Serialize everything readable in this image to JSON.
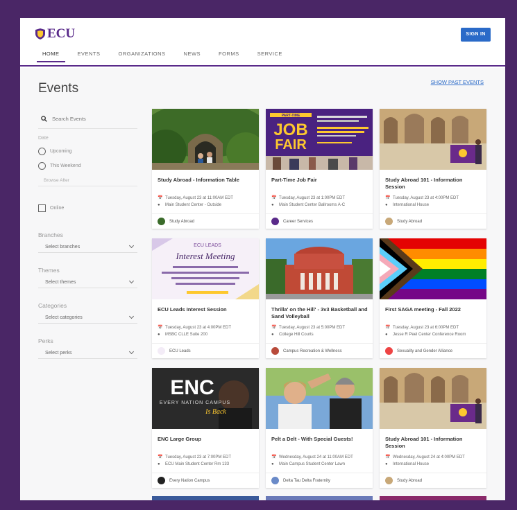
{
  "header": {
    "logo_text": "ECU",
    "nav": [
      "HOME",
      "EVENTS",
      "ORGANIZATIONS",
      "NEWS",
      "FORMS",
      "SERVICE"
    ],
    "active_nav": 0,
    "signin_label": "SIGN IN"
  },
  "page": {
    "title": "Events",
    "show_past_label": "SHOW PAST EVENTS"
  },
  "sidebar": {
    "search_placeholder": "Search Events",
    "date_label": "Date",
    "radio_options": [
      "Upcoming",
      "This Weekend"
    ],
    "date_input_placeholder": "Browse After",
    "online_label": "Online",
    "filters": [
      {
        "label": "Branches",
        "select": "Select branches"
      },
      {
        "label": "Themes",
        "select": "Select themes"
      },
      {
        "label": "Categories",
        "select": "Select categories"
      },
      {
        "label": "Perks",
        "select": "Select perks"
      }
    ]
  },
  "events": [
    {
      "title": "Study Abroad - Information Table",
      "datetime": "Tuesday, August 23 at 11:00AM EDT",
      "location": "Main Student Center - Outside",
      "org": "Study Abroad",
      "image": "garden-hut",
      "accent": "#3a6b2a"
    },
    {
      "title": "Part-Time Job Fair",
      "datetime": "Tuesday, August 23 at 1:00PM EDT",
      "location": "Main Student Center Ballrooms A-C",
      "org": "Career Services",
      "image": "job-fair",
      "accent": "#5a2a8a"
    },
    {
      "title": "Study Abroad 101 - Information Session",
      "datetime": "Tuesday, August 23 at 4:00PM EDT",
      "location": "International House",
      "org": "Study Abroad",
      "image": "ruins",
      "accent": "#c8a878"
    },
    {
      "title": "ECU Leads Interest Session",
      "datetime": "Tuesday, August 23 at 4:00PM EDT",
      "location": "MSBC CLLE Suite 200",
      "org": "ECU Leads",
      "image": "leads-flyer",
      "accent": "#f3ecf7"
    },
    {
      "title": "Thrilla' on the Hill' - 3v3 Basketball and Sand Volleyball",
      "datetime": "Tuesday, August 23 at 5:00PM EDT",
      "location": "College Hill Courts",
      "org": "Campus Recreation & Wellness",
      "image": "building",
      "accent": "#b84a3a"
    },
    {
      "title": "First SAGA meeting - Fall 2022",
      "datetime": "Tuesday, August 23 at 6:00PM EDT",
      "location": "Jesse R Peel Center Conference Room",
      "org": "Sexuality and Gender Alliance",
      "image": "pride-flag",
      "accent": "#e44"
    },
    {
      "title": "ENC Large Group",
      "datetime": "Tuesday, August 23 at 7:00PM EDT",
      "location": "ECU Main Student Center Rm 133",
      "org": "Every Nation Campus",
      "image": "enc",
      "accent": "#222"
    },
    {
      "title": "Pelt a Delt - With Special Guests!",
      "datetime": "Wednesday, August 24 at 11:00AM EDT",
      "location": "Main Campus Student Center Lawn",
      "org": "Delta Tau Delta Fraternity",
      "image": "people",
      "accent": "#6a8ac8"
    },
    {
      "title": "Study Abroad 101 - Information Session",
      "datetime": "Wednesday, August 24 at 4:00PM EDT",
      "location": "International House",
      "org": "Study Abroad",
      "image": "ruins",
      "accent": "#c8a878"
    }
  ],
  "job_fair_graphic": {
    "line1": "PART-TIME",
    "line2": "JOB",
    "line3": "FAIR"
  },
  "leads_graphic": {
    "line1": "ECU LEADS",
    "line2": "Interest Meeting"
  },
  "enc_graphic": {
    "big": "ENC",
    "sub": "EVERY NATION CAMPUS",
    "script": "Is Back"
  }
}
